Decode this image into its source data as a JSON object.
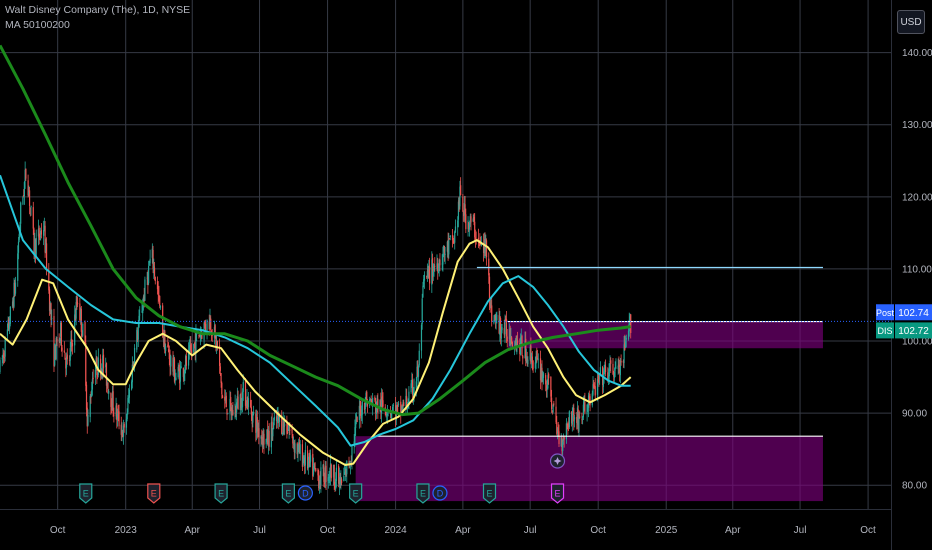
{
  "header": {
    "symbol_line": "Walt Disney Company (The), 1D, NYSE",
    "indicator_line": "MA 50100200"
  },
  "currency_button": "USD",
  "price_tags": [
    {
      "label": "Post",
      "value": "102.74",
      "price": 102.74,
      "color": "#2962ff"
    },
    {
      "label": "DIS",
      "value": "102.72",
      "price": 102.72,
      "color": "#089981"
    }
  ],
  "event_markers": [
    {
      "letter": "E",
      "date": "2022-11-08",
      "color": "#26a69a"
    },
    {
      "letter": "E",
      "date": "2023-02-08",
      "color": "#ef5350"
    },
    {
      "letter": "E",
      "date": "2023-05-10",
      "color": "#26a69a"
    },
    {
      "letter": "E",
      "date": "2023-08-09",
      "color": "#26a69a"
    },
    {
      "letter": "D",
      "date": "2023-09-01",
      "color": "#2962ff"
    },
    {
      "letter": "E",
      "date": "2023-11-08",
      "color": "#26a69a"
    },
    {
      "letter": "E",
      "date": "2024-02-07",
      "color": "#26a69a"
    },
    {
      "letter": "D",
      "date": "2024-03-01",
      "color": "#2962ff"
    },
    {
      "letter": "E",
      "date": "2024-05-07",
      "color": "#26a69a"
    },
    {
      "letter": "E",
      "date": "2024-08-07",
      "color": "#e040fb"
    }
  ],
  "chart_data": {
    "type": "line",
    "x_range": [
      "2022-07-15",
      "2025-11-01"
    ],
    "ylim": [
      76.7,
      147.3
    ],
    "y_ticks": [
      80,
      90,
      100,
      110,
      120,
      130,
      140
    ],
    "x_ticks": [
      {
        "label": "Jul",
        "date": "2022-07-01"
      },
      {
        "label": "Oct",
        "date": "2022-10-01"
      },
      {
        "label": "2023",
        "date": "2023-01-01"
      },
      {
        "label": "Apr",
        "date": "2023-04-01"
      },
      {
        "label": "Jul",
        "date": "2023-07-01"
      },
      {
        "label": "Oct",
        "date": "2023-10-01"
      },
      {
        "label": "2024",
        "date": "2024-01-01"
      },
      {
        "label": "Apr",
        "date": "2024-04-01"
      },
      {
        "label": "Jul",
        "date": "2024-07-01"
      },
      {
        "label": "Oct",
        "date": "2024-10-01"
      },
      {
        "label": "2025",
        "date": "2025-01-01"
      },
      {
        "label": "Apr",
        "date": "2025-04-01"
      },
      {
        "label": "Jul",
        "date": "2025-07-01"
      },
      {
        "label": "Oct",
        "date": "2025-10-01"
      }
    ],
    "grid": true,
    "colors": {
      "up": "#26a69a",
      "down": "#ef5350",
      "ma50": "#fff176",
      "ma100": "#26c6da",
      "ma200": "#1b8a1b"
    },
    "price_path": [
      [
        "2022-07-15",
        96
      ],
      [
        "2022-07-25",
        101
      ],
      [
        "2022-08-05",
        108
      ],
      [
        "2022-08-12",
        118
      ],
      [
        "2022-08-20",
        124
      ],
      [
        "2022-08-30",
        113
      ],
      [
        "2022-09-12",
        116
      ],
      [
        "2022-09-26",
        98
      ],
      [
        "2022-10-05",
        101
      ],
      [
        "2022-10-15",
        96
      ],
      [
        "2022-10-28",
        106
      ],
      [
        "2022-11-07",
        99
      ],
      [
        "2022-11-10",
        88
      ],
      [
        "2022-11-18",
        96
      ],
      [
        "2022-12-01",
        97
      ],
      [
        "2022-12-15",
        91
      ],
      [
        "2022-12-30",
        87
      ],
      [
        "2023-01-12",
        98
      ],
      [
        "2023-01-25",
        106
      ],
      [
        "2023-02-05",
        112
      ],
      [
        "2023-02-10",
        109
      ],
      [
        "2023-02-22",
        100
      ],
      [
        "2023-03-10",
        95
      ],
      [
        "2023-03-25",
        97
      ],
      [
        "2023-04-10",
        101
      ],
      [
        "2023-04-25",
        103
      ],
      [
        "2023-05-05",
        99
      ],
      [
        "2023-05-12",
        92
      ],
      [
        "2023-05-25",
        90
      ],
      [
        "2023-06-10",
        93
      ],
      [
        "2023-06-28",
        88
      ],
      [
        "2023-07-10",
        86
      ],
      [
        "2023-07-25",
        89
      ],
      [
        "2023-08-09",
        88
      ],
      [
        "2023-08-20",
        85
      ],
      [
        "2023-09-05",
        83
      ],
      [
        "2023-09-20",
        81
      ],
      [
        "2023-10-05",
        82
      ],
      [
        "2023-10-20",
        80
      ],
      [
        "2023-11-01",
        84
      ],
      [
        "2023-11-10",
        89
      ],
      [
        "2023-11-20",
        92
      ],
      [
        "2023-12-05",
        91
      ],
      [
        "2023-12-20",
        91
      ],
      [
        "2024-01-05",
        90
      ],
      [
        "2024-01-20",
        92
      ],
      [
        "2024-02-01",
        96
      ],
      [
        "2024-02-08",
        108
      ],
      [
        "2024-02-20",
        110
      ],
      [
        "2024-03-05",
        112
      ],
      [
        "2024-03-20",
        114
      ],
      [
        "2024-03-28",
        120
      ],
      [
        "2024-04-05",
        117
      ],
      [
        "2024-04-15",
        116
      ],
      [
        "2024-04-25",
        113
      ],
      [
        "2024-05-05",
        113
      ],
      [
        "2024-05-08",
        104
      ],
      [
        "2024-05-20",
        102
      ],
      [
        "2024-06-05",
        101
      ],
      [
        "2024-06-20",
        99
      ],
      [
        "2024-07-01",
        98
      ],
      [
        "2024-07-15",
        96
      ],
      [
        "2024-07-28",
        93
      ],
      [
        "2024-08-05",
        88
      ],
      [
        "2024-08-12",
        86
      ],
      [
        "2024-08-25",
        90
      ],
      [
        "2024-09-05",
        89
      ],
      [
        "2024-09-20",
        92
      ],
      [
        "2024-10-05",
        95
      ],
      [
        "2024-10-20",
        96
      ],
      [
        "2024-11-01",
        96
      ],
      [
        "2024-11-14",
        102.7
      ]
    ],
    "series": [
      {
        "name": "MA 50",
        "color": "#fff176",
        "points": [
          [
            "2022-07-15",
            101
          ],
          [
            "2022-08-01",
            99.5
          ],
          [
            "2022-08-20",
            103
          ],
          [
            "2022-09-10",
            108.5
          ],
          [
            "2022-09-25",
            108
          ],
          [
            "2022-10-15",
            103
          ],
          [
            "2022-11-10",
            99
          ],
          [
            "2022-11-25",
            96
          ],
          [
            "2022-12-15",
            94
          ],
          [
            "2023-01-01",
            94
          ],
          [
            "2023-01-15",
            97
          ],
          [
            "2023-02-01",
            100
          ],
          [
            "2023-02-20",
            101
          ],
          [
            "2023-03-10",
            100
          ],
          [
            "2023-04-01",
            98
          ],
          [
            "2023-04-20",
            99.5
          ],
          [
            "2023-05-10",
            99
          ],
          [
            "2023-06-01",
            96
          ],
          [
            "2023-06-25",
            93
          ],
          [
            "2023-07-25",
            90
          ],
          [
            "2023-08-25",
            87
          ],
          [
            "2023-09-25",
            84.5
          ],
          [
            "2023-10-25",
            82.8
          ],
          [
            "2023-11-05",
            83
          ],
          [
            "2023-11-25",
            86
          ],
          [
            "2023-12-15",
            88.5
          ],
          [
            "2024-01-05",
            89.5
          ],
          [
            "2024-01-25",
            92
          ],
          [
            "2024-02-15",
            97
          ],
          [
            "2024-03-05",
            104
          ],
          [
            "2024-03-25",
            111
          ],
          [
            "2024-04-10",
            113.5
          ],
          [
            "2024-04-20",
            114
          ],
          [
            "2024-05-05",
            113
          ],
          [
            "2024-05-25",
            110
          ],
          [
            "2024-06-15",
            106
          ],
          [
            "2024-07-05",
            102
          ],
          [
            "2024-07-25",
            99
          ],
          [
            "2024-08-15",
            95
          ],
          [
            "2024-09-01",
            92.5
          ],
          [
            "2024-09-20",
            91.5
          ],
          [
            "2024-10-10",
            92.5
          ],
          [
            "2024-11-01",
            93.8
          ],
          [
            "2024-11-14",
            95
          ]
        ]
      },
      {
        "name": "MA 100",
        "color": "#26c6da",
        "points": [
          [
            "2022-07-15",
            123
          ],
          [
            "2022-08-15",
            114
          ],
          [
            "2022-09-15",
            110
          ],
          [
            "2022-10-15",
            107.5
          ],
          [
            "2022-11-15",
            105
          ],
          [
            "2022-12-15",
            103
          ],
          [
            "2023-01-15",
            102.5
          ],
          [
            "2023-02-15",
            102.5
          ],
          [
            "2023-03-15",
            102
          ],
          [
            "2023-04-15",
            101.5
          ],
          [
            "2023-05-15",
            100.5
          ],
          [
            "2023-06-15",
            99
          ],
          [
            "2023-07-15",
            97
          ],
          [
            "2023-08-15",
            94
          ],
          [
            "2023-09-15",
            91
          ],
          [
            "2023-10-15",
            88
          ],
          [
            "2023-11-01",
            85.5
          ],
          [
            "2023-11-20",
            86
          ],
          [
            "2023-12-10",
            87
          ],
          [
            "2024-01-01",
            87.8
          ],
          [
            "2024-01-25",
            89
          ],
          [
            "2024-02-20",
            92
          ],
          [
            "2024-03-15",
            96
          ],
          [
            "2024-04-10",
            101
          ],
          [
            "2024-05-05",
            105.5
          ],
          [
            "2024-05-25",
            108
          ],
          [
            "2024-06-15",
            109
          ],
          [
            "2024-07-05",
            107.5
          ],
          [
            "2024-07-25",
            105
          ],
          [
            "2024-08-15",
            102
          ],
          [
            "2024-09-05",
            98.5
          ],
          [
            "2024-09-25",
            96
          ],
          [
            "2024-10-15",
            94.5
          ],
          [
            "2024-11-01",
            93.8
          ],
          [
            "2024-11-14",
            93.8
          ]
        ]
      },
      {
        "name": "MA 200",
        "color": "#1b8a1b",
        "points": [
          [
            "2022-07-15",
            141
          ],
          [
            "2022-08-15",
            135
          ],
          [
            "2022-09-15",
            128.5
          ],
          [
            "2022-10-15",
            122
          ],
          [
            "2022-11-15",
            116
          ],
          [
            "2022-12-15",
            110
          ],
          [
            "2023-01-15",
            106
          ],
          [
            "2023-02-15",
            103.5
          ],
          [
            "2023-03-15",
            102
          ],
          [
            "2023-04-15",
            101
          ],
          [
            "2023-05-15",
            101
          ],
          [
            "2023-06-15",
            100
          ],
          [
            "2023-07-15",
            98
          ],
          [
            "2023-08-15",
            96.5
          ],
          [
            "2023-09-15",
            95
          ],
          [
            "2023-10-15",
            93.8
          ],
          [
            "2023-11-15",
            92
          ],
          [
            "2023-12-15",
            90.5
          ],
          [
            "2024-01-10",
            89.8
          ],
          [
            "2024-02-01",
            90
          ],
          [
            "2024-03-01",
            92
          ],
          [
            "2024-04-01",
            94.5
          ],
          [
            "2024-05-01",
            97
          ],
          [
            "2024-06-01",
            98.8
          ],
          [
            "2024-07-01",
            99.8
          ],
          [
            "2024-08-01",
            100.5
          ],
          [
            "2024-09-01",
            101
          ],
          [
            "2024-10-01",
            101.5
          ],
          [
            "2024-11-01",
            101.8
          ],
          [
            "2024-11-14",
            102
          ]
        ]
      }
    ],
    "zones": [
      {
        "start": "2024-06-01",
        "end": "2025-08-01",
        "low": 99,
        "high": 102.7,
        "color": "#800080"
      },
      {
        "start": "2023-11-08",
        "end": "2025-08-01",
        "low": 77.8,
        "high": 86.8,
        "color": "#800080"
      }
    ],
    "levels": [
      {
        "start": "2024-04-20",
        "end": "2025-08-01",
        "price": 110.2,
        "color": "#8fd9ff"
      },
      {
        "start": "2024-06-01",
        "end": "2025-08-01",
        "price": 102.7,
        "color": "#ffffff"
      },
      {
        "start": "2023-12-05",
        "end": "2025-08-01",
        "price": 86.8,
        "color": "#ffffff"
      }
    ],
    "current_price_line": 102.72
  }
}
